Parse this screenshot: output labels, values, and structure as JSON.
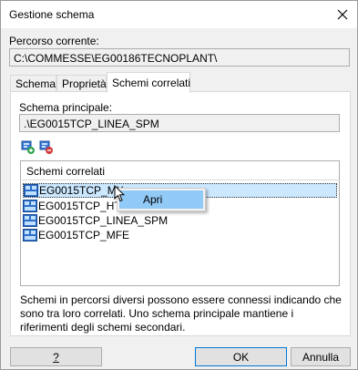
{
  "window": {
    "title": "Gestione schema",
    "close_icon": "close-icon"
  },
  "path": {
    "label": "Percorso corrente:",
    "value": "C:\\COMMESSE\\EG00186TECNOPLANT\\"
  },
  "tabs": [
    {
      "label": "Schema",
      "active": false
    },
    {
      "label": "Proprietà",
      "active": false
    },
    {
      "label": "Schemi correlati",
      "active": true
    }
  ],
  "main_schema": {
    "label": "Schema principale:",
    "value": ".\\EG0015TCP_LINEA_SPM"
  },
  "toolbar": {
    "add_icon": "add-schema-icon",
    "remove_icon": "remove-schema-icon"
  },
  "related": {
    "header": "Schemi correlati",
    "items": [
      {
        "label": "EG0015TCP_MX",
        "selected": true
      },
      {
        "label": "EG0015TCP_HTE",
        "selected": false
      },
      {
        "label": "EG0015TCP_LINEA_SPM",
        "selected": false
      },
      {
        "label": "EG0015TCP_MFE",
        "selected": false
      }
    ]
  },
  "context_menu": {
    "items": [
      {
        "label": "Apri"
      }
    ]
  },
  "description": "Schemi in percorsi diversi possono essere connessi indicando che sono tra loro correlati. Uno schema principale mantiene i riferimenti degli schemi secondari.",
  "buttons": {
    "help": "?",
    "ok": "OK",
    "cancel": "Annulla"
  }
}
